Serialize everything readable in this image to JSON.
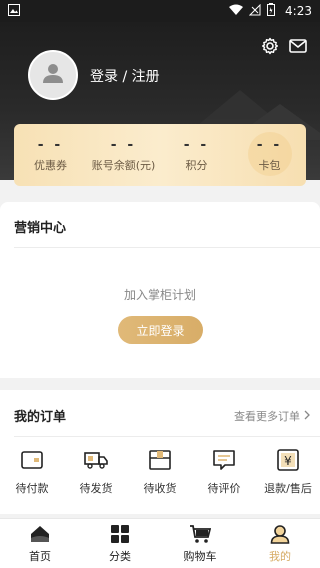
{
  "status_bar": {
    "time": "4:23"
  },
  "header": {
    "login_label": "登录 / 注册"
  },
  "stats": [
    {
      "value": "- -",
      "label": "优惠券"
    },
    {
      "value": "- -",
      "label": "账号余额(元)"
    },
    {
      "value": "- -",
      "label": "积分"
    },
    {
      "value": "- -",
      "label": "卡包"
    }
  ],
  "marketing": {
    "title": "营销中心",
    "join_text": "加入掌柜计划",
    "login_button": "立即登录"
  },
  "orders": {
    "title": "我的订单",
    "more_link": "查看更多订单",
    "items": [
      {
        "label": "待付款",
        "icon": "wallet-icon"
      },
      {
        "label": "待发货",
        "icon": "truck-icon"
      },
      {
        "label": "待收货",
        "icon": "package-icon"
      },
      {
        "label": "待评价",
        "icon": "comment-icon"
      },
      {
        "label": "退款/售后",
        "icon": "refund-icon"
      }
    ]
  },
  "tabs": [
    {
      "label": "首页",
      "icon": "home-icon"
    },
    {
      "label": "分类",
      "icon": "grid-icon"
    },
    {
      "label": "购物车",
      "icon": "cart-icon"
    },
    {
      "label": "我的",
      "icon": "user-icon",
      "active": true
    }
  ],
  "colors": {
    "accent": "#d6ab63",
    "header_dark": "#1e1e1e",
    "card_gold": "#f7e1b5"
  }
}
